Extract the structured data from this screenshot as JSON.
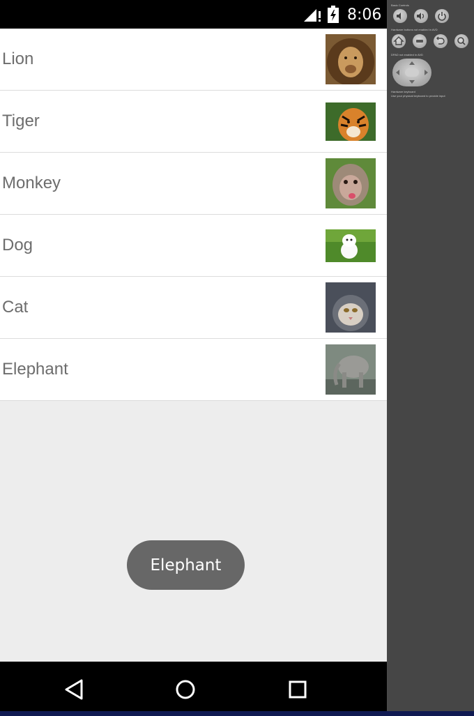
{
  "status_bar": {
    "time": "8:06"
  },
  "animals": [
    {
      "name": "Lion",
      "thumb_icon": "lion-photo"
    },
    {
      "name": "Tiger",
      "thumb_icon": "tiger-photo"
    },
    {
      "name": "Monkey",
      "thumb_icon": "monkey-photo"
    },
    {
      "name": "Dog",
      "thumb_icon": "dog-photo"
    },
    {
      "name": "Cat",
      "thumb_icon": "cat-photo"
    },
    {
      "name": "Elephant",
      "thumb_icon": "elephant-photo"
    }
  ],
  "toast": {
    "text": "Elephant"
  },
  "nav_bar": {
    "icons": [
      "back-icon",
      "home-icon",
      "recents-icon"
    ]
  },
  "emulator_panel": {
    "text_lines": [
      "Basic Controls",
      "Hardware buttons not enabled in AVD",
      "DPAD not enabled in AVD",
      "Hardware keyboard",
      "Use your physical keyboard to provide input"
    ]
  },
  "colors": {
    "status_bar": "#000000",
    "list_background": "#ffffff",
    "screen_background": "#ededed",
    "label_text": "#6d6d6d",
    "toast_background": "#676767",
    "side_panel": "#464646"
  }
}
